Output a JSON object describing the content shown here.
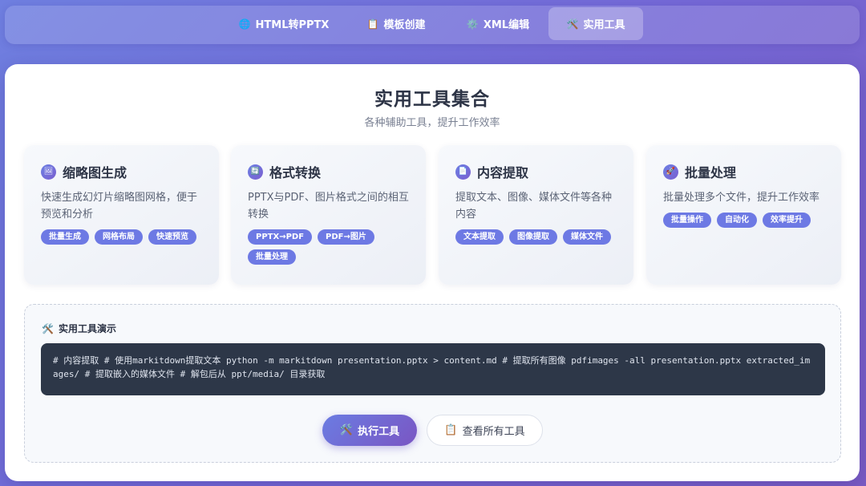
{
  "nav": {
    "tabs": [
      {
        "icon": "🌐",
        "label": "HTML转PPTX",
        "active": false
      },
      {
        "icon": "📋",
        "label": "模板创建",
        "active": false
      },
      {
        "icon": "⚙️",
        "label": "XML编辑",
        "active": false
      },
      {
        "icon": "🛠️",
        "label": "实用工具",
        "active": true
      }
    ]
  },
  "main": {
    "title": "实用工具集合",
    "subtitle": "各种辅助工具，提升工作效率"
  },
  "cards": [
    {
      "icon": "🖼",
      "title": "缩略图生成",
      "desc": "快速生成幻灯片缩略图网格，便于预览和分析",
      "tags": [
        "批量生成",
        "网格布局",
        "快速预览"
      ]
    },
    {
      "icon": "🔄",
      "title": "格式转换",
      "desc": "PPTX与PDF、图片格式之间的相互转换",
      "tags": [
        "PPTX→PDF",
        "PDF→图片",
        "批量处理"
      ]
    },
    {
      "icon": "📄",
      "title": "内容提取",
      "desc": "提取文本、图像、媒体文件等各种内容",
      "tags": [
        "文本提取",
        "图像提取",
        "媒体文件"
      ]
    },
    {
      "icon": "🚀",
      "title": "批量处理",
      "desc": "批量处理多个文件，提升工作效率",
      "tags": [
        "批量操作",
        "自动化",
        "效率提升"
      ]
    }
  ],
  "demo": {
    "icon": "🛠️",
    "title": "实用工具演示",
    "code": "# 内容提取 # 使用markitdown提取文本 python -m markitdown presentation.pptx > content.md # 提取所有图像 pdfimages -all presentation.pptx extracted_images/ # 提取嵌入的媒体文件 # 解包后从 ppt/media/ 目录获取",
    "run_icon": "🛠️",
    "run_label": "执行工具",
    "view_icon": "📋",
    "view_label": "查看所有工具"
  },
  "colors": {
    "accent": "#6d79e4",
    "accent_dark": "#7a56c3",
    "code_bg": "#2d3748",
    "title_text": "#2d3446"
  }
}
